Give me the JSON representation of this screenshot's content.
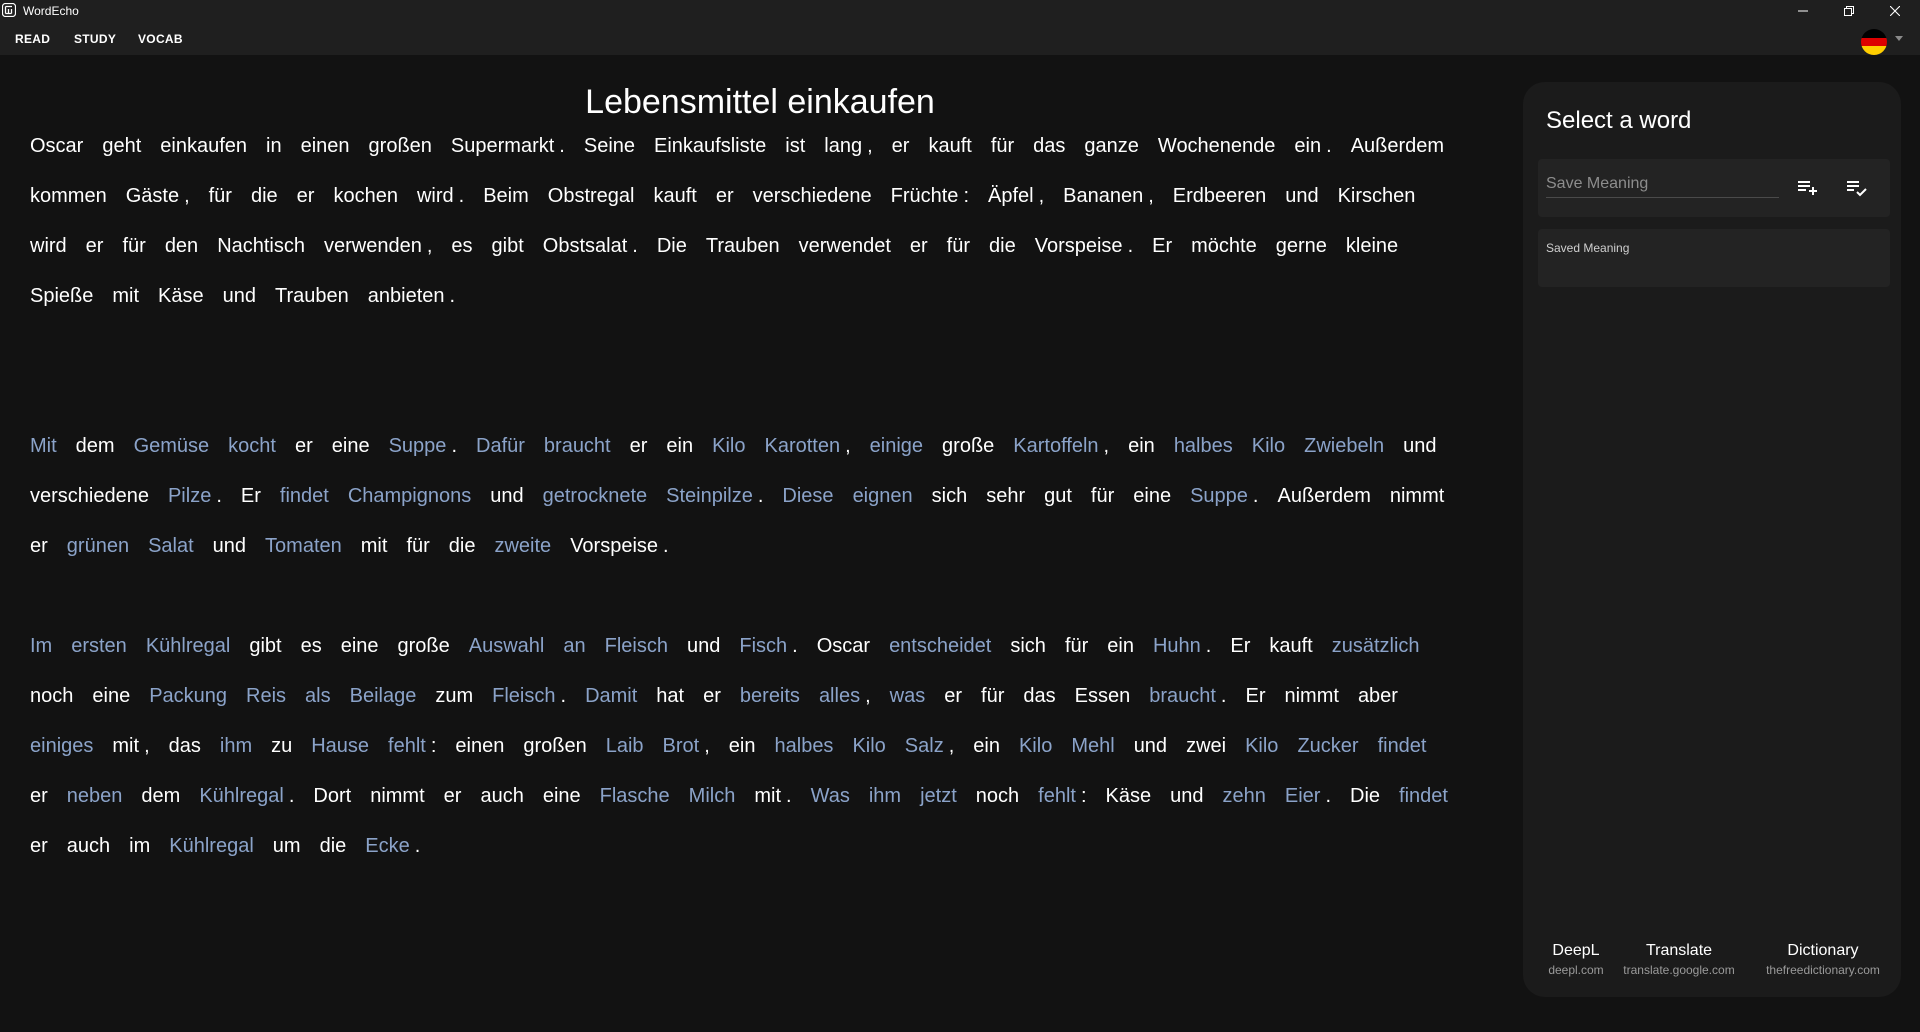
{
  "window": {
    "title": "WordEcho"
  },
  "menu": [
    "READ",
    "STUDY",
    "VOCAB"
  ],
  "colors": {
    "new_word": "#8ba3c9",
    "known_word": "#ffffff",
    "background": "#121212",
    "panel": "#1b1b1b"
  },
  "language": {
    "flag": "de",
    "flag_colors": [
      "#000000",
      "#dd0000",
      "#ffce00"
    ]
  },
  "document": {
    "title": "Lebensmittel einkaufen",
    "paragraphs": [
      [
        [
          "Oscar",
          "k"
        ],
        [
          "geht",
          "k"
        ],
        [
          "einkaufen",
          "k"
        ],
        [
          "in",
          "k"
        ],
        [
          "einen",
          "k"
        ],
        [
          "großen",
          "k"
        ],
        [
          "Supermarkt",
          "k"
        ],
        [
          ".",
          "p"
        ],
        [
          "Seine",
          "k"
        ],
        [
          "Einkaufsliste",
          "k"
        ],
        [
          "ist",
          "k"
        ],
        [
          "lang",
          "k"
        ],
        [
          ",",
          "p"
        ],
        [
          "er",
          "k"
        ],
        [
          "kauft",
          "k"
        ],
        [
          "für",
          "k"
        ],
        [
          "das",
          "k"
        ],
        [
          "ganze",
          "k"
        ],
        [
          "Wochenende",
          "k"
        ],
        [
          "ein",
          "k"
        ],
        [
          ".",
          "p"
        ],
        [
          "Außerdem",
          "k"
        ],
        [
          "kommen",
          "k"
        ],
        [
          "Gäste",
          "k"
        ],
        [
          ",",
          "p"
        ],
        [
          "für",
          "k"
        ],
        [
          "die",
          "k"
        ],
        [
          "er",
          "k"
        ],
        [
          "kochen",
          "k"
        ],
        [
          "wird",
          "k"
        ],
        [
          ".",
          "p"
        ],
        [
          "Beim",
          "k"
        ],
        [
          "Obstregal",
          "k"
        ],
        [
          "kauft",
          "k"
        ],
        [
          "er",
          "k"
        ],
        [
          "verschiedene",
          "k"
        ],
        [
          "Früchte",
          "k"
        ],
        [
          ":",
          "p"
        ],
        [
          "Äpfel",
          "k"
        ],
        [
          ",",
          "p"
        ],
        [
          "Bananen",
          "k"
        ],
        [
          ",",
          "p"
        ],
        [
          "Erdbeeren",
          "k"
        ],
        [
          "und",
          "k"
        ],
        [
          "Kirschen",
          "k"
        ],
        [
          "wird",
          "k"
        ],
        [
          "er",
          "k"
        ],
        [
          "für",
          "k"
        ],
        [
          "den",
          "k"
        ],
        [
          "Nachtisch",
          "k"
        ],
        [
          "verwenden",
          "k"
        ],
        [
          ",",
          "p"
        ],
        [
          "es",
          "k"
        ],
        [
          "gibt",
          "k"
        ],
        [
          "Obstsalat",
          "k"
        ],
        [
          ".",
          "p"
        ],
        [
          "Die",
          "k"
        ],
        [
          "Trauben",
          "k"
        ],
        [
          "verwendet",
          "k"
        ],
        [
          "er",
          "k"
        ],
        [
          "für",
          "k"
        ],
        [
          "die",
          "k"
        ],
        [
          "Vorspeise",
          "k"
        ],
        [
          ".",
          "p"
        ],
        [
          "Er",
          "k"
        ],
        [
          "möchte",
          "k"
        ],
        [
          "gerne",
          "k"
        ],
        [
          "kleine",
          "k"
        ],
        [
          "Spieße",
          "k"
        ],
        [
          "mit",
          "k"
        ],
        [
          "Käse",
          "k"
        ],
        [
          "und",
          "k"
        ],
        [
          "Trauben",
          "k"
        ],
        [
          "anbieten",
          "k"
        ],
        [
          ".",
          "p"
        ]
      ],
      [
        [
          "Mit",
          "n"
        ],
        [
          "dem",
          "k"
        ],
        [
          "Gemüse",
          "n"
        ],
        [
          "kocht",
          "n"
        ],
        [
          "er",
          "k"
        ],
        [
          "eine",
          "k"
        ],
        [
          "Suppe",
          "n"
        ],
        [
          ".",
          "p"
        ],
        [
          "Dafür",
          "n"
        ],
        [
          "braucht",
          "n"
        ],
        [
          "er",
          "k"
        ],
        [
          "ein",
          "k"
        ],
        [
          "Kilo",
          "n"
        ],
        [
          "Karotten",
          "n"
        ],
        [
          ",",
          "p"
        ],
        [
          "einige",
          "n"
        ],
        [
          "große",
          "k"
        ],
        [
          "Kartoffeln",
          "n"
        ],
        [
          ",",
          "p"
        ],
        [
          "ein",
          "k"
        ],
        [
          "halbes",
          "n"
        ],
        [
          "Kilo",
          "n"
        ],
        [
          "Zwiebeln",
          "n"
        ],
        [
          "und",
          "k"
        ],
        [
          "verschiedene",
          "k"
        ],
        [
          "Pilze",
          "n"
        ],
        [
          ".",
          "p"
        ],
        [
          "Er",
          "k"
        ],
        [
          "findet",
          "n"
        ],
        [
          "Champignons",
          "n"
        ],
        [
          "und",
          "k"
        ],
        [
          "getrocknete",
          "n"
        ],
        [
          "Steinpilze",
          "n"
        ],
        [
          ".",
          "p"
        ],
        [
          "Diese",
          "n"
        ],
        [
          "eignen",
          "n"
        ],
        [
          "sich",
          "k"
        ],
        [
          "sehr",
          "k"
        ],
        [
          "gut",
          "k"
        ],
        [
          "für",
          "k"
        ],
        [
          "eine",
          "k"
        ],
        [
          "Suppe",
          "n"
        ],
        [
          ".",
          "p"
        ],
        [
          "Außerdem",
          "k"
        ],
        [
          "nimmt",
          "k"
        ],
        [
          "er",
          "k"
        ],
        [
          "grünen",
          "n"
        ],
        [
          "Salat",
          "n"
        ],
        [
          "und",
          "k"
        ],
        [
          "Tomaten",
          "n"
        ],
        [
          "mit",
          "k"
        ],
        [
          "für",
          "k"
        ],
        [
          "die",
          "k"
        ],
        [
          "zweite",
          "n"
        ],
        [
          "Vorspeise",
          "k"
        ],
        [
          ".",
          "p"
        ]
      ],
      [
        [
          "Im",
          "n"
        ],
        [
          "ersten",
          "n"
        ],
        [
          "Kühlregal",
          "n"
        ],
        [
          "gibt",
          "k"
        ],
        [
          "es",
          "k"
        ],
        [
          "eine",
          "k"
        ],
        [
          "große",
          "k"
        ],
        [
          "Auswahl",
          "n"
        ],
        [
          "an",
          "n"
        ],
        [
          "Fleisch",
          "n"
        ],
        [
          "und",
          "k"
        ],
        [
          "Fisch",
          "n"
        ],
        [
          ".",
          "p"
        ],
        [
          "Oscar",
          "k"
        ],
        [
          "entscheidet",
          "n"
        ],
        [
          "sich",
          "k"
        ],
        [
          "für",
          "k"
        ],
        [
          "ein",
          "k"
        ],
        [
          "Huhn",
          "n"
        ],
        [
          ".",
          "p"
        ],
        [
          "Er",
          "k"
        ],
        [
          "kauft",
          "k"
        ],
        [
          "zusätzlich",
          "n"
        ],
        [
          "noch",
          "k"
        ],
        [
          "eine",
          "k"
        ],
        [
          "Packung",
          "n"
        ],
        [
          "Reis",
          "n"
        ],
        [
          "als",
          "n"
        ],
        [
          "Beilage",
          "n"
        ],
        [
          "zum",
          "k"
        ],
        [
          "Fleisch",
          "n"
        ],
        [
          ".",
          "p"
        ],
        [
          "Damit",
          "n"
        ],
        [
          "hat",
          "k"
        ],
        [
          "er",
          "k"
        ],
        [
          "bereits",
          "n"
        ],
        [
          "alles",
          "n"
        ],
        [
          ",",
          "p"
        ],
        [
          "was",
          "n"
        ],
        [
          "er",
          "k"
        ],
        [
          "für",
          "k"
        ],
        [
          "das",
          "k"
        ],
        [
          "Essen",
          "k"
        ],
        [
          "braucht",
          "n"
        ],
        [
          ".",
          "p"
        ],
        [
          "Er",
          "k"
        ],
        [
          "nimmt",
          "k"
        ],
        [
          "aber",
          "k"
        ],
        [
          "einiges",
          "n"
        ],
        [
          "mit",
          "k"
        ],
        [
          ",",
          "p"
        ],
        [
          "das",
          "k"
        ],
        [
          "ihm",
          "n"
        ],
        [
          "zu",
          "k"
        ],
        [
          "Hause",
          "n"
        ],
        [
          "fehlt",
          "n"
        ],
        [
          ":",
          "p"
        ],
        [
          "einen",
          "k"
        ],
        [
          "großen",
          "k"
        ],
        [
          "Laib",
          "n"
        ],
        [
          "Brot",
          "n"
        ],
        [
          ",",
          "p"
        ],
        [
          "ein",
          "k"
        ],
        [
          "halbes",
          "n"
        ],
        [
          "Kilo",
          "n"
        ],
        [
          "Salz",
          "n"
        ],
        [
          ",",
          "p"
        ],
        [
          "ein",
          "k"
        ],
        [
          "Kilo",
          "n"
        ],
        [
          "Mehl",
          "n"
        ],
        [
          "und",
          "k"
        ],
        [
          "zwei",
          "k"
        ],
        [
          "Kilo",
          "n"
        ],
        [
          "Zucker",
          "n"
        ],
        [
          "findet",
          "n"
        ],
        [
          "er",
          "k"
        ],
        [
          "neben",
          "n"
        ],
        [
          "dem",
          "k"
        ],
        [
          "Kühlregal",
          "n"
        ],
        [
          ".",
          "p"
        ],
        [
          "Dort",
          "k"
        ],
        [
          "nimmt",
          "k"
        ],
        [
          "er",
          "k"
        ],
        [
          "auch",
          "k"
        ],
        [
          "eine",
          "k"
        ],
        [
          "Flasche",
          "n"
        ],
        [
          "Milch",
          "n"
        ],
        [
          "mit",
          "k"
        ],
        [
          ".",
          "p"
        ],
        [
          "Was",
          "n"
        ],
        [
          "ihm",
          "n"
        ],
        [
          "jetzt",
          "n"
        ],
        [
          "noch",
          "k"
        ],
        [
          "fehlt",
          "n"
        ],
        [
          ":",
          "p"
        ],
        [
          "Käse",
          "k"
        ],
        [
          "und",
          "k"
        ],
        [
          "zehn",
          "n"
        ],
        [
          "Eier",
          "n"
        ],
        [
          ".",
          "p"
        ],
        [
          "Die",
          "k"
        ],
        [
          "findet",
          "n"
        ],
        [
          "er",
          "k"
        ],
        [
          "auch",
          "k"
        ],
        [
          "im",
          "k"
        ],
        [
          "Kühlregal",
          "n"
        ],
        [
          "um",
          "k"
        ],
        [
          "die",
          "k"
        ],
        [
          "Ecke",
          "n"
        ],
        [
          ".",
          "p"
        ]
      ]
    ]
  },
  "sidebar": {
    "heading": "Select a word",
    "save_meaning_placeholder": "Save Meaning",
    "saved_meaning_label": "Saved Meaning",
    "links": [
      {
        "name": "DeepL",
        "url": "deepl.com"
      },
      {
        "name": "Translate",
        "url": "translate.google.com"
      },
      {
        "name": "Dictionary",
        "url": "thefreedictionary.com"
      }
    ]
  }
}
